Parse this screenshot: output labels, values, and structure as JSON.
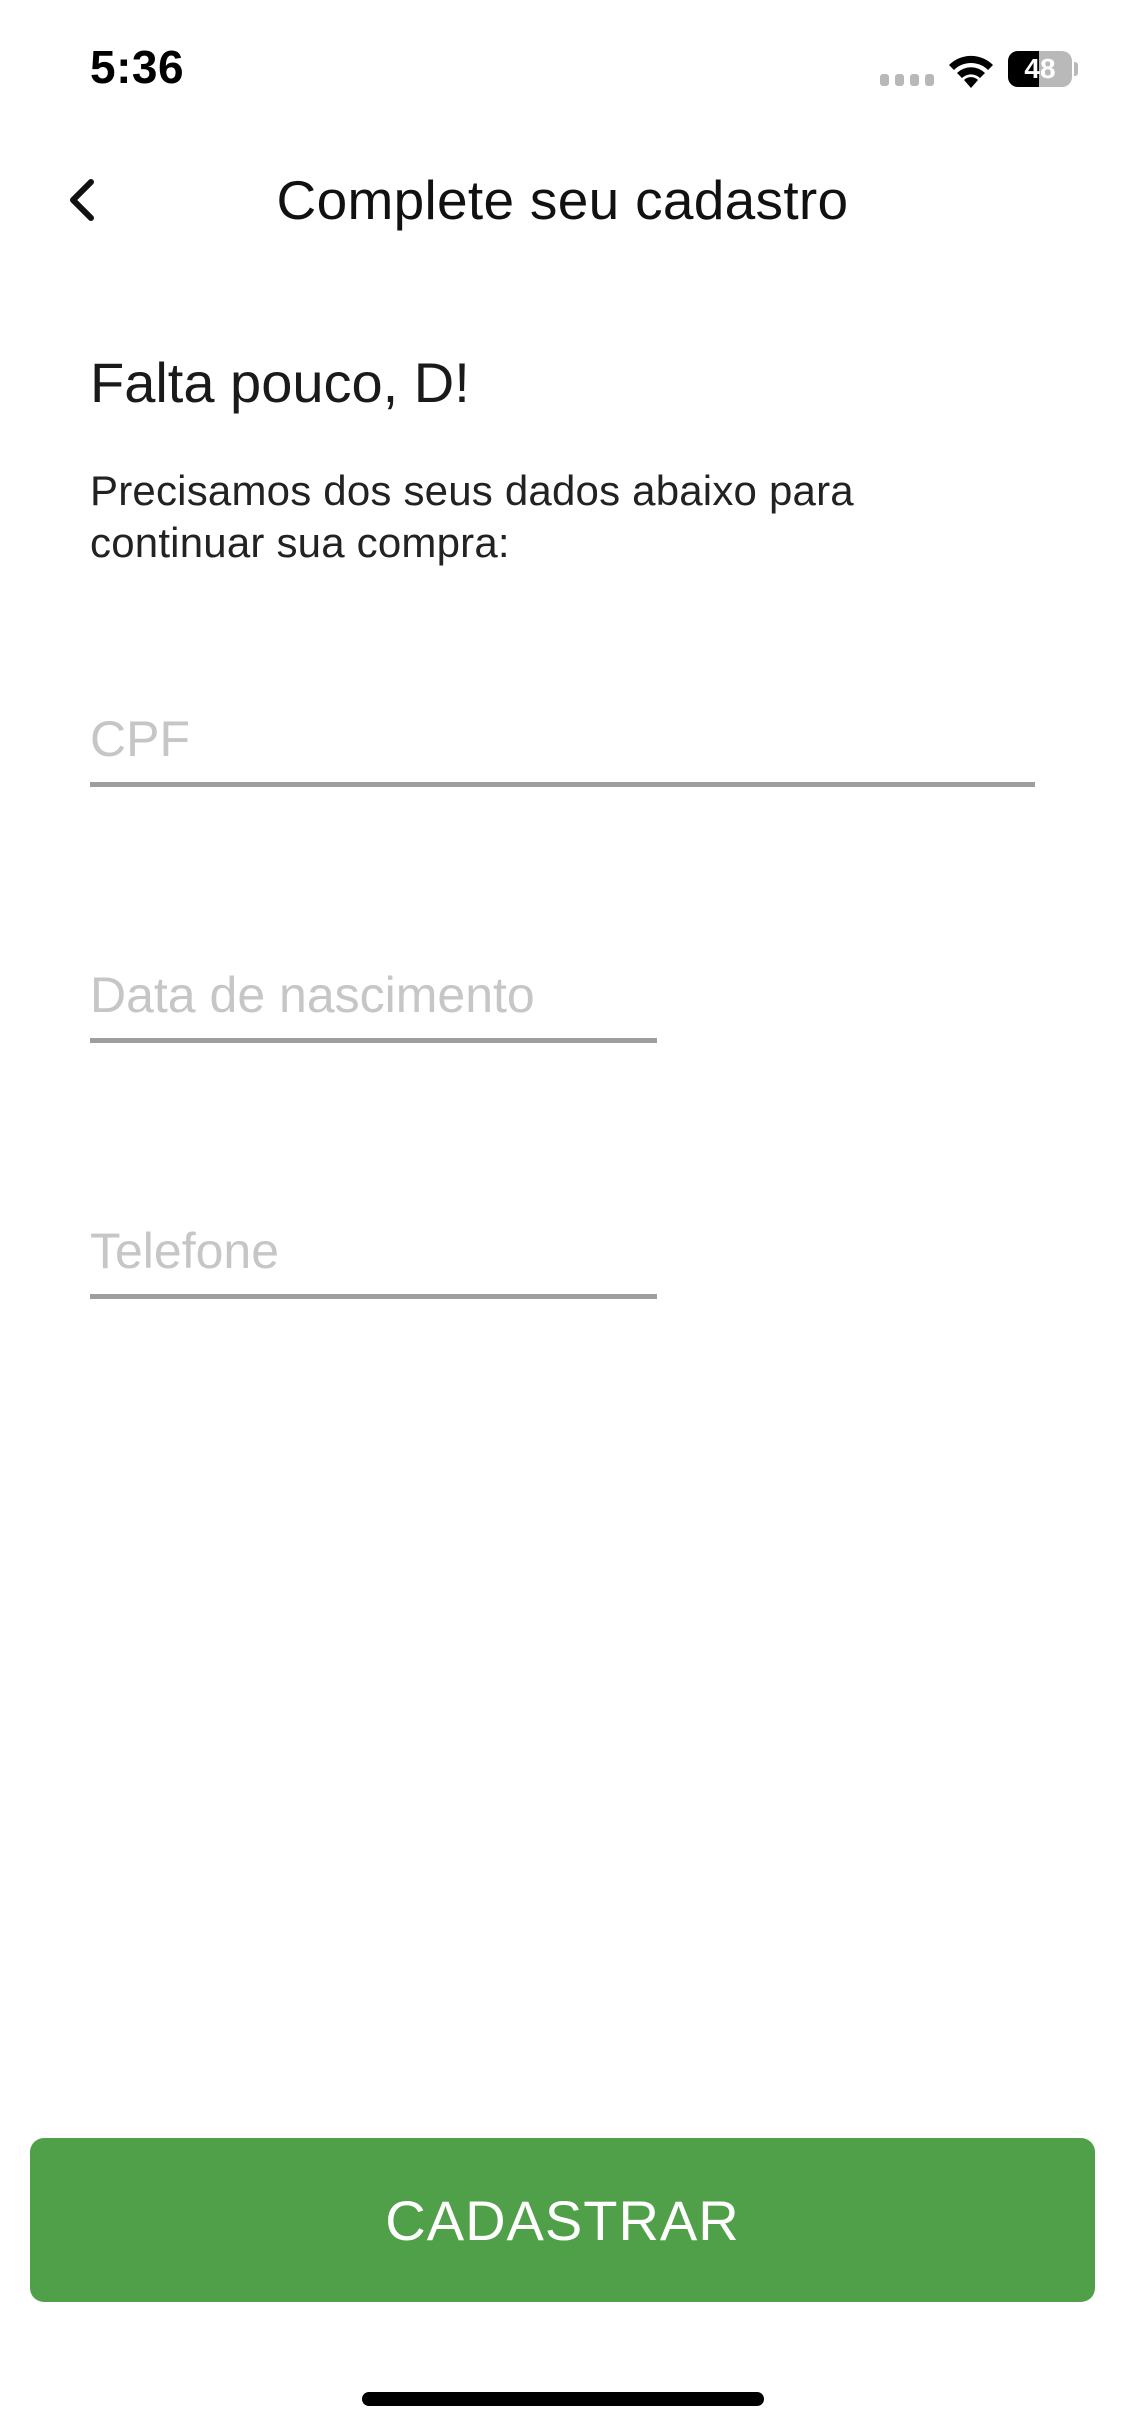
{
  "status_bar": {
    "time": "5:36",
    "battery_level": "48",
    "battery_fraction": 0.48
  },
  "header": {
    "title": "Complete seu cadastro",
    "back_icon": "chevron-left-icon"
  },
  "intro": {
    "greeting": "Falta pouco, D!",
    "description": "Precisamos dos seus dados abaixo para continuar sua compra:"
  },
  "form": {
    "cpf": {
      "placeholder": "CPF",
      "value": ""
    },
    "birth_date": {
      "placeholder": "Data de nascimento",
      "value": ""
    },
    "phone": {
      "placeholder": "Telefone",
      "value": ""
    },
    "submit_label": "CADASTRAR"
  },
  "colors": {
    "accent": "#50a04a",
    "input_underline": "#9e9e9e",
    "placeholder": "#c6c6c6"
  }
}
